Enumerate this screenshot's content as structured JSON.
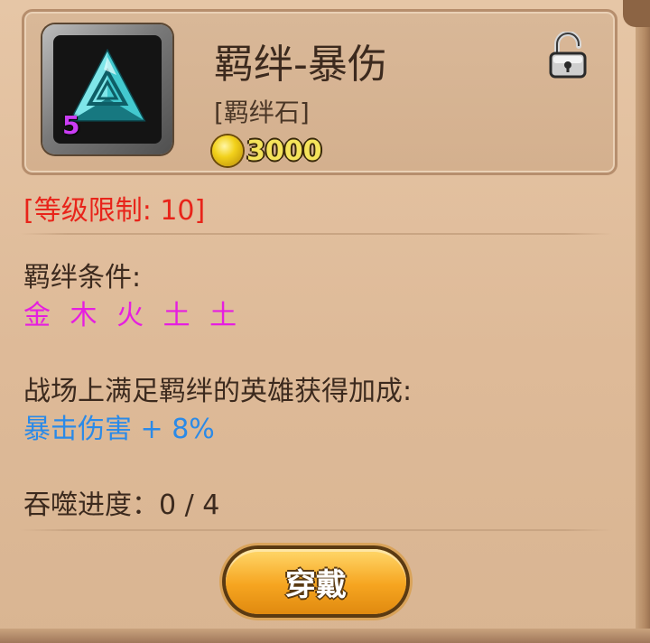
{
  "item": {
    "name": "羁绊-暴伤",
    "type": "[羁绊石]",
    "level_badge": "5",
    "price": "3000",
    "icon": "teal-triangle-gem-icon",
    "lock_icon": "unlocked-padlock-icon"
  },
  "info": {
    "level_limit": "[等级限制: 10]",
    "condition_title": "羁绊条件:",
    "condition_values": "金 木 火 土 土",
    "bonus_title": "战场上满足羁绊的英雄获得加成:",
    "bonus_value": "暴击伤害 + 8%",
    "progress": "吞噬进度：0 / 4"
  },
  "actions": {
    "wear_label": "穿戴"
  },
  "colors": {
    "limit_red": "#e8241a",
    "condition_magenta": "#e61ee0",
    "bonus_blue": "#2a8ae8",
    "price_gold": "#f5e45b",
    "level_purple": "#c93df4"
  }
}
